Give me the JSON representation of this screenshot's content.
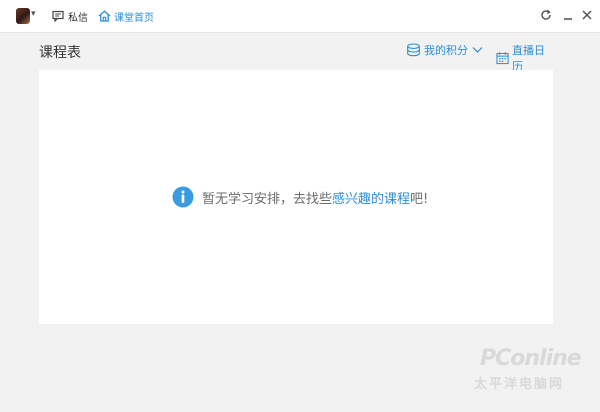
{
  "topbar": {
    "messages_label": "私信",
    "home_label": "课堂首页"
  },
  "header": {
    "title": "课程表",
    "points_label": "我的积分",
    "calendar_label": "直播日历"
  },
  "empty_state": {
    "text_before": "暂无学习安排，去找些",
    "link_text": "感兴趣的课程",
    "text_after": "吧!"
  },
  "watermark": {
    "logo_text": "PConline",
    "sub_text": "太平洋电脑网"
  },
  "colors": {
    "accent": "#2b8ed6",
    "background": "#f2f2f2",
    "panel": "#ffffff"
  },
  "icons": [
    "avatar",
    "chevron-down-icon",
    "message-icon",
    "home-icon",
    "refresh-icon",
    "minimize-icon",
    "close-icon",
    "coins-icon",
    "calendar-icon",
    "info-icon"
  ]
}
